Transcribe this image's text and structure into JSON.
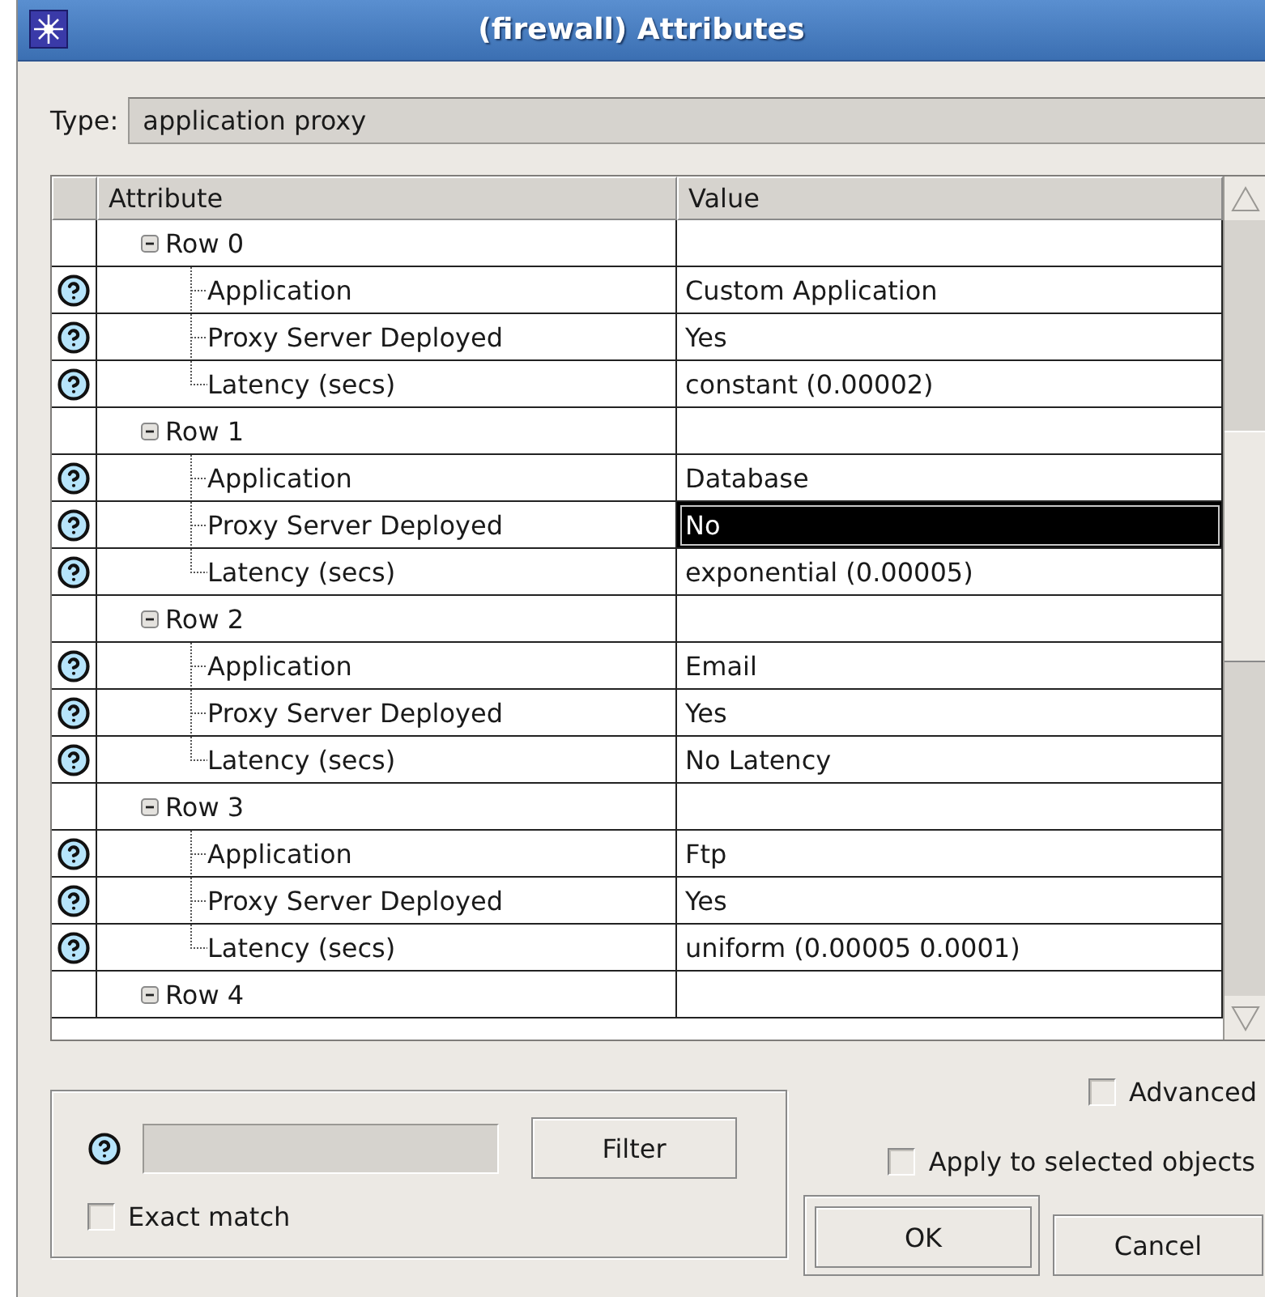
{
  "window": {
    "title": "(firewall) Attributes"
  },
  "type": {
    "label": "Type:",
    "value": "application proxy"
  },
  "table": {
    "columns": [
      "Attribute",
      "Value"
    ],
    "groups": [
      {
        "label": "Row 0",
        "expanded": true,
        "children": [
          {
            "attribute": "Application",
            "value": "Custom Application",
            "selected": false
          },
          {
            "attribute": "Proxy Server Deployed",
            "value": "Yes",
            "selected": false
          },
          {
            "attribute": "Latency (secs)",
            "value": "constant (0.00002)",
            "selected": false
          }
        ]
      },
      {
        "label": "Row 1",
        "expanded": true,
        "children": [
          {
            "attribute": "Application",
            "value": "Database",
            "selected": false
          },
          {
            "attribute": "Proxy Server Deployed",
            "value": "No",
            "selected": true
          },
          {
            "attribute": "Latency (secs)",
            "value": "exponential (0.00005)",
            "selected": false
          }
        ]
      },
      {
        "label": "Row 2",
        "expanded": true,
        "children": [
          {
            "attribute": "Application",
            "value": "Email",
            "selected": false
          },
          {
            "attribute": "Proxy Server Deployed",
            "value": "Yes",
            "selected": false
          },
          {
            "attribute": "Latency (secs)",
            "value": "No Latency",
            "selected": false
          }
        ]
      },
      {
        "label": "Row 3",
        "expanded": true,
        "children": [
          {
            "attribute": "Application",
            "value": "Ftp",
            "selected": false
          },
          {
            "attribute": "Proxy Server Deployed",
            "value": "Yes",
            "selected": false
          },
          {
            "attribute": "Latency (secs)",
            "value": "uniform (0.00005 0.0001)",
            "selected": false
          }
        ]
      },
      {
        "label": "Row 4",
        "expanded": true
      }
    ]
  },
  "filter_button": {
    "label": "Filter"
  },
  "exact_match": {
    "label": "Exact match",
    "checked": false
  },
  "advanced": {
    "label": "Advanced",
    "checked": false
  },
  "apply_to_selected": {
    "label": "Apply to selected objects",
    "checked": false
  },
  "buttons": [
    {
      "label": "OK",
      "default": true
    },
    {
      "label": "Cancel",
      "default": false
    }
  ]
}
